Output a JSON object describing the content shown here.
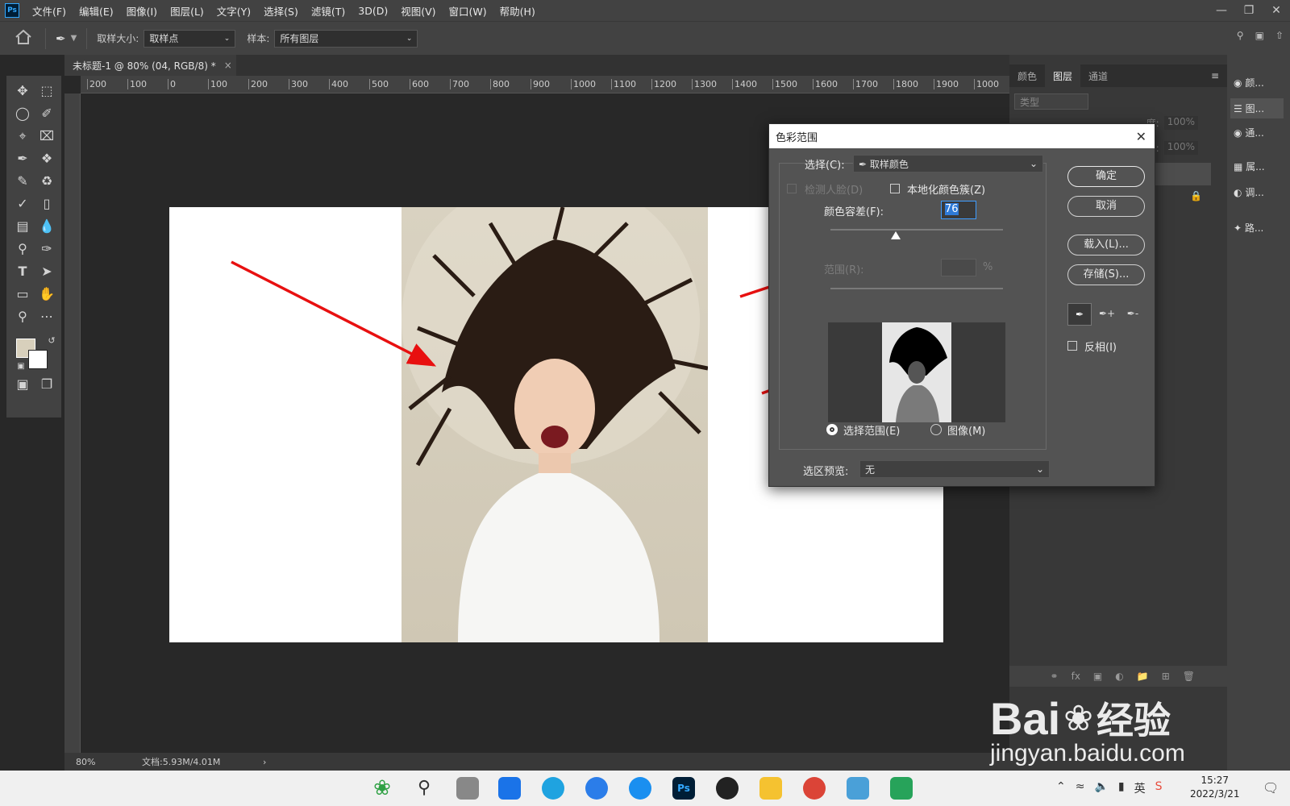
{
  "app": {
    "logo": "Ps",
    "menu": [
      "文件(F)",
      "编辑(E)",
      "图像(I)",
      "图层(L)",
      "文字(Y)",
      "选择(S)",
      "滤镜(T)",
      "3D(D)",
      "视图(V)",
      "窗口(W)",
      "帮助(H)"
    ]
  },
  "options_bar": {
    "sample_size_label": "取样大小:",
    "sample_size_value": "取样点",
    "sample_label": "样本:",
    "sample_value": "所有图层"
  },
  "document": {
    "tab_title": "未标题-1 @ 80% (04, RGB/8) *",
    "zoom": "80%",
    "doc_info": "文档:5.93M/4.01M",
    "ruler_ticks": [
      "200",
      "100",
      "0",
      "100",
      "200",
      "300",
      "400",
      "500",
      "600",
      "700",
      "800",
      "900",
      "1000",
      "1100",
      "1200",
      "1300",
      "1400",
      "1500",
      "1600",
      "1700",
      "1800",
      "1900",
      "1000"
    ]
  },
  "panels": {
    "tabs": [
      "颜色",
      "图层",
      "通道"
    ],
    "active_tab": "图层",
    "filter_placeholder": "类型",
    "opacity_label": "度:",
    "opacity_value": "100%",
    "fill_label": "充:",
    "fill_value": "100%",
    "side_items": [
      "颜...",
      "图...",
      "通...",
      "属...",
      "调...",
      "路..."
    ]
  },
  "dialog": {
    "title": "色彩范围",
    "select_label": "选择(C):",
    "select_value": "取样颜色",
    "detect_faces": "检测人脸(D)",
    "localized": "本地化颜色簇(Z)",
    "fuzziness_label": "颜色容差(F):",
    "fuzziness_value": "76",
    "fuzziness_fraction": 0.38,
    "range_label": "范围(R):",
    "range_unit": "%",
    "radio_selection": "选择范围(E)",
    "radio_image": "图像(M)",
    "preview_label": "选区预览:",
    "preview_value": "无",
    "ok": "确定",
    "cancel": "取消",
    "load": "载入(L)...",
    "save": "存储(S)...",
    "invert": "反相(I)"
  },
  "taskbar": {
    "time": "15:27",
    "date": "2022/3/21",
    "ime": "英"
  },
  "watermark": {
    "brand": "Bai",
    "brand_cn": "经验",
    "url": "jingyan.baidu.com"
  },
  "colors": {
    "arrow": "#e81010",
    "accent": "#31a8ff"
  }
}
